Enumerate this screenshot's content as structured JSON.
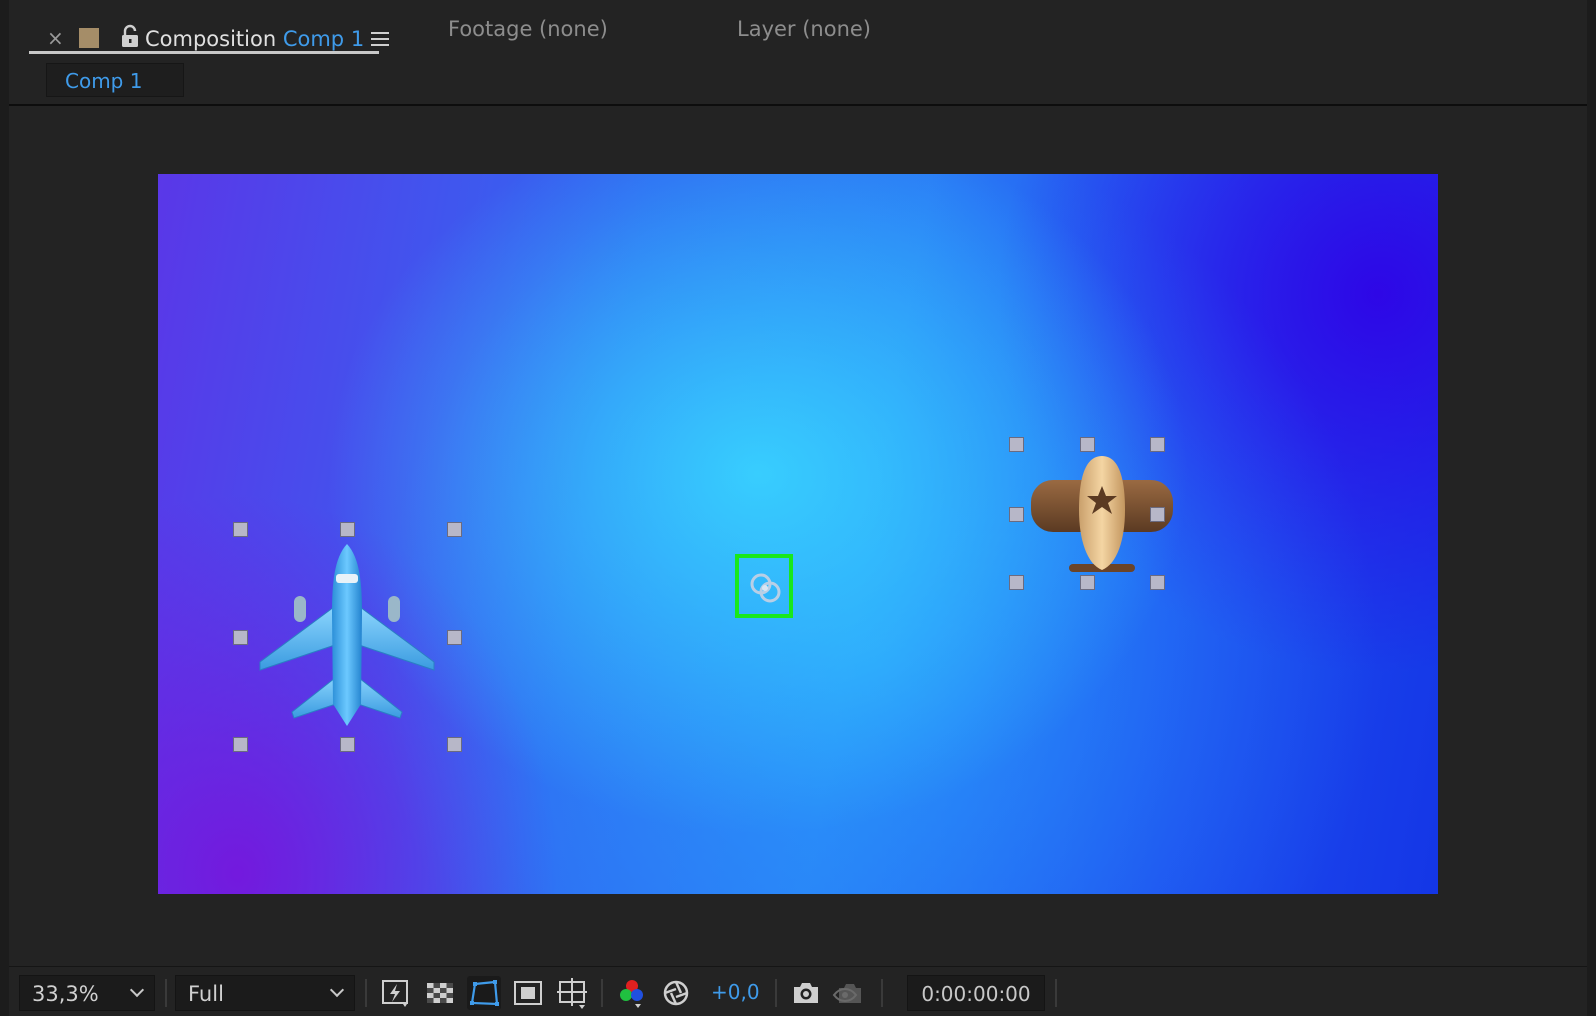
{
  "header": {
    "close_glyph": "×",
    "active_tab": {
      "prefix": "Composition",
      "comp_name": "Comp 1"
    },
    "inactive_tabs": [
      {
        "label": "Footage (none)"
      },
      {
        "label": "Layer (none)"
      }
    ],
    "label_color_hex": "#a58d68"
  },
  "breadcrumb": {
    "label": "Comp 1"
  },
  "viewer": {
    "layers": [
      {
        "name": "blue-jet-plane",
        "selected": true
      },
      {
        "name": "propeller-plane",
        "selected": true
      },
      {
        "name": "null-object-icon",
        "highlight_color": "#19e81c"
      }
    ]
  },
  "toolbar": {
    "zoom": "33,3%",
    "resolution": "Full",
    "exposure": "+0,0",
    "timecode": "0:00:00:00",
    "icons": [
      "fast-preview-icon",
      "transparency-grid-icon",
      "mask-path-visibility-icon",
      "region-of-interest-icon",
      "grid-guides-icon",
      "color-channels-icon",
      "color-management-icon",
      "snapshot-icon",
      "show-snapshot-icon"
    ]
  }
}
